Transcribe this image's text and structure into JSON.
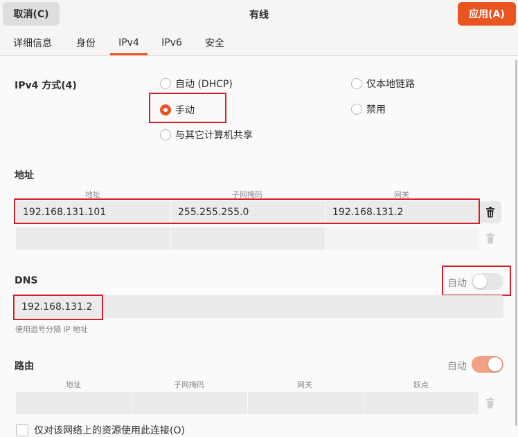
{
  "header": {
    "title": "有线",
    "cancel_label": "取消(C)",
    "apply_label": "应用(A)"
  },
  "tabs": [
    {
      "label": "详细信息"
    },
    {
      "label": "身份"
    },
    {
      "label": "IPv4",
      "active": true
    },
    {
      "label": "IPv6"
    },
    {
      "label": "安全"
    }
  ],
  "ipv4_method": {
    "label": "IPv4 方式(4)",
    "options": [
      {
        "label": "自动 (DHCP)",
        "selected": false
      },
      {
        "label": "手动",
        "selected": true
      },
      {
        "label": "与其它计算机共享",
        "selected": false
      },
      {
        "label": "仅本地链路",
        "selected": false
      },
      {
        "label": "禁用",
        "selected": false
      }
    ]
  },
  "address": {
    "label": "地址",
    "columns": [
      "地址",
      "子网掩码",
      "网关"
    ],
    "rows": [
      {
        "address": "192.168.131.101",
        "netmask": "255.255.255.0",
        "gateway": "192.168.131.2"
      },
      {
        "address": "",
        "netmask": "",
        "gateway": ""
      }
    ]
  },
  "dns": {
    "label": "DNS",
    "auto_label": "自动",
    "auto": false,
    "value": "192.168.131.2",
    "hint": "使用逗号分隔 IP 地址"
  },
  "routes": {
    "label": "路由",
    "auto_label": "自动",
    "auto": true,
    "columns": [
      "地址",
      "子网掩码",
      "网关",
      "跃点"
    ]
  },
  "only_local_resources": {
    "label": "仅对该网络上的资源使用此连接(O)",
    "checked": false
  },
  "colors": {
    "accent": "#e95420",
    "highlight_box": "#d41f2a"
  },
  "icons": {
    "delete": "trash-icon"
  }
}
